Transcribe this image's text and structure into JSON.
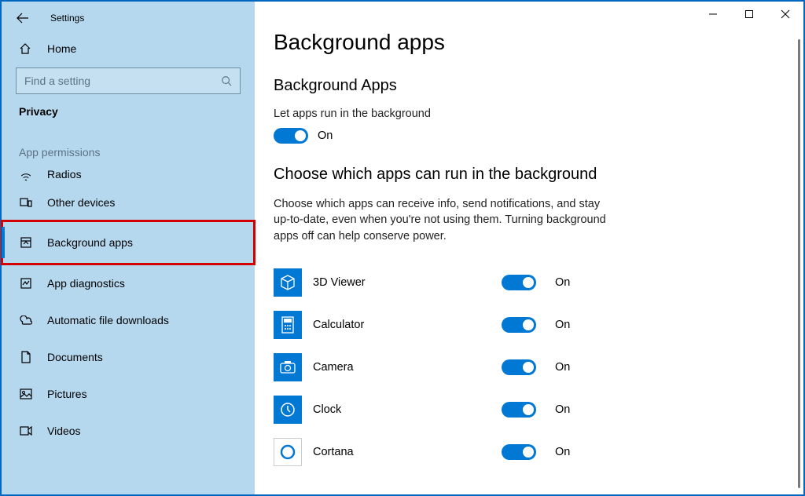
{
  "window": {
    "title": "Settings"
  },
  "sidebar": {
    "home": "Home",
    "search_placeholder": "Find a setting",
    "section": "Privacy",
    "group": "App permissions",
    "items": [
      {
        "icon": "radios-icon",
        "label": "Radios",
        "partial": true
      },
      {
        "icon": "other-devices-icon",
        "label": "Other devices"
      },
      {
        "icon": "background-apps-icon",
        "label": "Background apps",
        "selected": true,
        "highlighted": true
      },
      {
        "icon": "app-diagnostics-icon",
        "label": "App diagnostics"
      },
      {
        "icon": "downloads-icon",
        "label": "Automatic file downloads"
      },
      {
        "icon": "documents-icon",
        "label": "Documents"
      },
      {
        "icon": "pictures-icon",
        "label": "Pictures"
      },
      {
        "icon": "videos-icon",
        "label": "Videos"
      }
    ]
  },
  "main": {
    "title": "Background apps",
    "section1_title": "Background Apps",
    "master_toggle_label": "Let apps run in the background",
    "master_toggle_state": "On",
    "section2_title": "Choose which apps can run in the background",
    "description": "Choose which apps can receive info, send notifications, and stay up-to-date, even when you're not using them. Turning background apps off can help conserve power.",
    "apps": [
      {
        "name": "3D Viewer",
        "state": "On",
        "icon": "cube-icon"
      },
      {
        "name": "Calculator",
        "state": "On",
        "icon": "calculator-icon"
      },
      {
        "name": "Camera",
        "state": "On",
        "icon": "camera-icon"
      },
      {
        "name": "Clock",
        "state": "On",
        "icon": "clock-icon"
      },
      {
        "name": "Cortana",
        "state": "On",
        "icon": "cortana-icon"
      }
    ]
  }
}
